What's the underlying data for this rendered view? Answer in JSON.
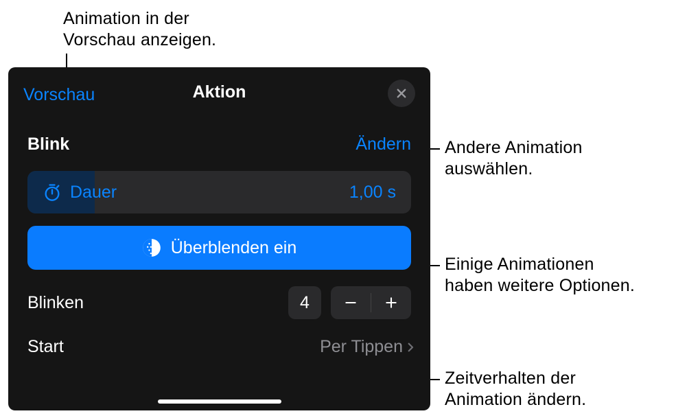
{
  "callouts": {
    "preview": "Animation in der\nVorschau anzeigen.",
    "change": "Andere Animation\nauswählen.",
    "options": "Einige Animationen\nhaben weitere Optionen.",
    "timing": "Zeitverhalten der\nAnimation ändern."
  },
  "panel": {
    "preview_link": "Vorschau",
    "title": "Aktion",
    "animation_name": "Blink",
    "change_link": "Ändern",
    "duration": {
      "label": "Dauer",
      "value": "1,00 s"
    },
    "blend_button": "Überblenden ein",
    "blink": {
      "label": "Blinken",
      "value": "4"
    },
    "start": {
      "label": "Start",
      "value": "Per Tippen"
    }
  }
}
